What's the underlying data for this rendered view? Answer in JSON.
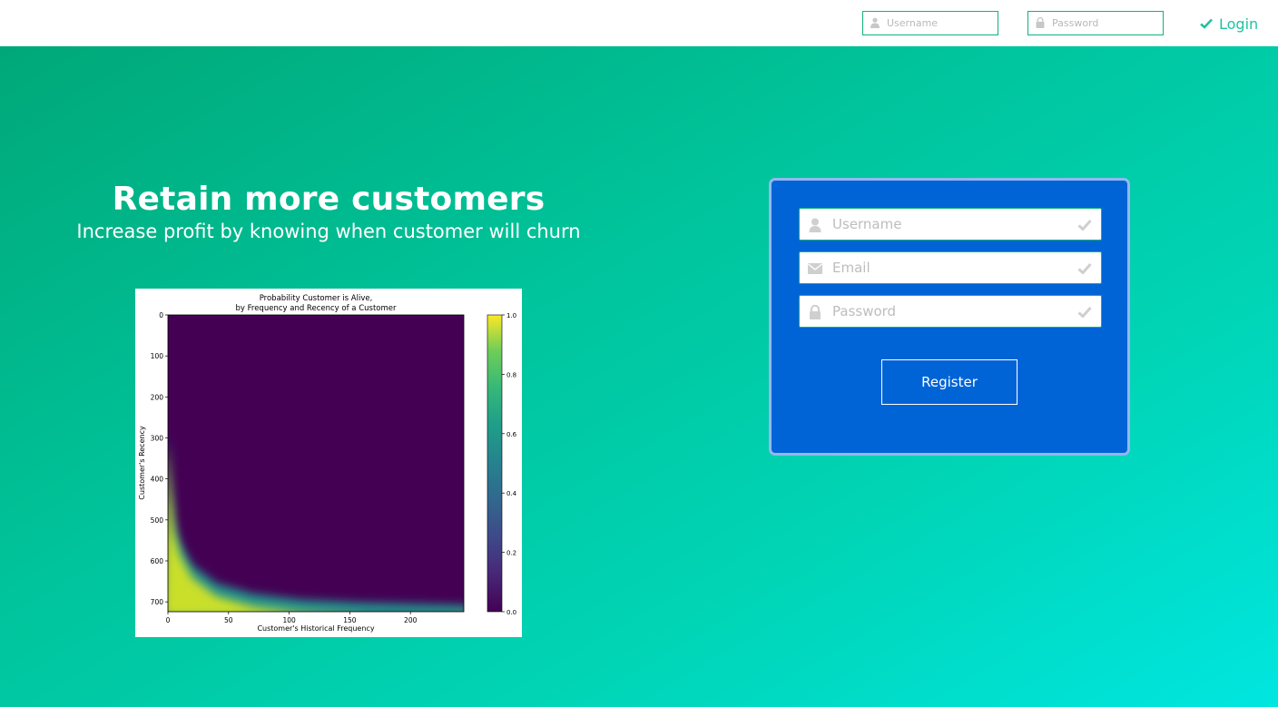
{
  "header": {
    "username_placeholder": "Username",
    "password_placeholder": "Password",
    "login_label": "Login"
  },
  "hero": {
    "title": "Retain more customers",
    "subtitle": "Increase profit by knowing when customer will churn"
  },
  "register": {
    "username_placeholder": "Username",
    "email_placeholder": "Email",
    "password_placeholder": "Password",
    "button_label": "Register"
  },
  "colors": {
    "brand_green": "#00b386",
    "card_blue": "#0064d7",
    "login_accent": "#1cc3a2"
  },
  "chart_data": {
    "type": "heatmap",
    "title": "Probability Customer is Alive,\nby Frequency and Recency of a Customer",
    "xlabel": "Customer's Historical Frequency",
    "ylabel": "Customer's Recency",
    "xlim": [
      0,
      244
    ],
    "ylim": [
      0,
      724
    ],
    "x_ticks": [
      "0",
      "50",
      "100",
      "150",
      "200"
    ],
    "y_ticks": [
      "0",
      "100",
      "200",
      "300",
      "400",
      "500",
      "600",
      "700"
    ],
    "colorbar": {
      "min": 0.0,
      "max": 1.0,
      "ticks": [
        "0.0",
        "0.2",
        "0.4",
        "0.6",
        "0.8",
        "1.0"
      ],
      "colormap": "viridis"
    },
    "boundary_curve": {
      "description_values": "probability 0.5 contour (frequency, recency)",
      "frequency": [
        0,
        2,
        5,
        10,
        20,
        40,
        70,
        110,
        160,
        244
      ],
      "recency": [
        285,
        400,
        500,
        555,
        610,
        655,
        680,
        695,
        702,
        708
      ]
    }
  }
}
